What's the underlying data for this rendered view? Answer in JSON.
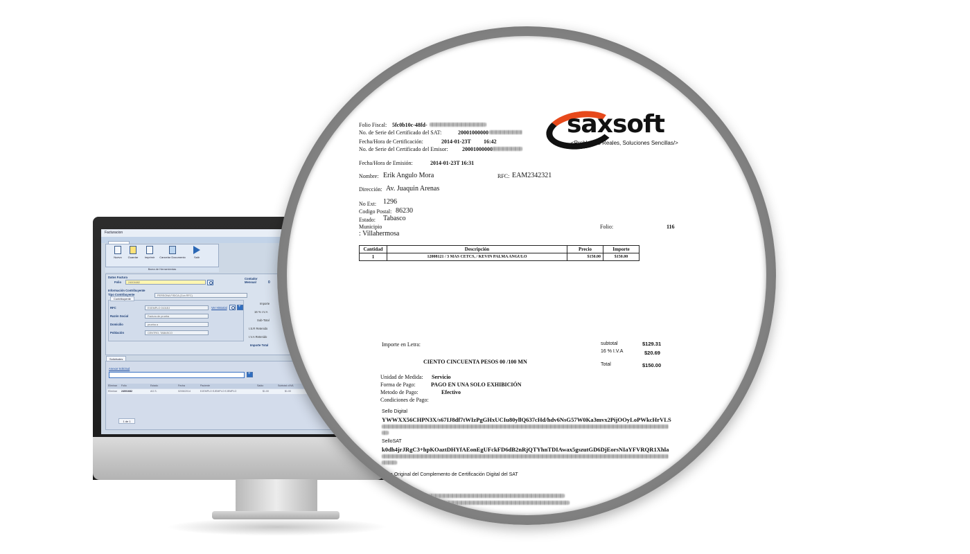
{
  "app": {
    "window_title": "Facturacion",
    "tab_label": "Procesos",
    "toolbar": {
      "nuevo": "Nuevo",
      "guardar": "Guardar",
      "imprimir": "Imprimir",
      "cancelar": "Cancelar Documento",
      "salir": "Salir",
      "caption": "Barra de Herramientas"
    },
    "datos_factura": "Datos Factura",
    "folio_label": "Folio",
    "folio_value": "24001682",
    "contador_label": "Contador Mensual",
    "contador_value": "0",
    "info_contribuyente": "Información Contribuyente",
    "tipo_label": "Tipo Contribuyente",
    "tipo_value": "PERSONA FISICA (Con RFC)",
    "contribuyente_tab": "Contribuyente",
    "rfc_label": "RFC",
    "rfc_value": "EXEMPLO 0101EJ",
    "ver_historial": "Ver Historial",
    "razon_label": "Razón Social",
    "razon_value": "Factura de prueba",
    "domicilio_label": "Domicilio",
    "domicilio_value": "prueba a",
    "poblacion_label": "Población",
    "poblacion_value": "CENTRO, TABASCO",
    "totals": [
      "Importe",
      "16 % I.V.A",
      "Sub-Total",
      "I.S.R Retenido",
      "I.V.A Retenido",
      "Importe Total"
    ],
    "solicitudes_tab": "Solicitudes",
    "anexar": "Anexar Solicitud",
    "grid_headers": [
      "Eliminar",
      "Folio",
      "Estado",
      "Fecha",
      "Paciente",
      "Saldo",
      "Subtotal c/IVA"
    ],
    "grid_row": [
      "Eliminar",
      "24001682",
      "AG.S.",
      "02/06/2014",
      "EJEMPLO EJEMPLO EJEMPLO",
      "$1.00",
      "$1.00"
    ],
    "pager": "1 de 1"
  },
  "invoice": {
    "folio_fiscal_label": "Folio Fiscal:",
    "folio_fiscal_value": "5fc0b10c-48fd-",
    "serie_sat_label": "No. de Serie del Certificado del SAT:",
    "serie_sat_value": "20001000000",
    "fecha_cert_label": "Fecha/Hora de Certificación:",
    "fecha_cert_date": "2014-01-23T",
    "fecha_cert_time": "16:42",
    "serie_emisor_label": "No. de Serie del Certificado del Emisor:",
    "serie_emisor_value": "20001000000",
    "fecha_emision_label": "Fecha/Hora de Emisión:",
    "fecha_emision_value": "2014-01-23T  16:31",
    "nombre_label": "Nombre:",
    "nombre_value": "Erik Angulo Mora",
    "rfc_label": "RFC:",
    "rfc_value": "EAM2342321",
    "direccion_label": "Dirección:",
    "direccion_value": "Av. Juaquin Arenas",
    "no_ext_label": "No Ext:",
    "no_ext_value": "1296",
    "cp_label": "Codigo Postal:",
    "cp_value": "86230",
    "estado_label": "Estado:",
    "estado_value": "Tabasco",
    "municipio_label": "Municipio",
    "municipio_value": ":  Villahermosa",
    "folio_label": "Folio:",
    "folio_value": "116",
    "table_headers": [
      "Cantidad",
      "Descripción",
      "Precio",
      "Importe"
    ],
    "table_rows": [
      [
        "1",
        "12008121  / 3 MAS CETCS,  / KEVIN  PALMA   ANGULO",
        "$150.00",
        "$150.00"
      ]
    ],
    "importe_letra_label": "Importe en Letra:",
    "importe_letra_value": "CIENTO CINCUENTA  PESOS 00 /100 MN",
    "subtotal_label": "subtotal",
    "subtotal_value": "$129.31",
    "iva_label": "16 % I.V.A",
    "iva_value": "$20.69",
    "total_label": "Total",
    "total_value": "$150.00",
    "unidad_label": "Unidad de Medida:",
    "unidad_value": "Servicio",
    "forma_label": "Forma de Pago:",
    "forma_value": "PAGO EN UNA SOLO EXHIBICIÓN",
    "metodo_label": "Metodo de Pago:",
    "metodo_value": "Efectivo",
    "condiciones_label": "Condiciones de Pago:",
    "sello_digital_label": "Sello Digital",
    "sello_digital_value": "YWWXX56CHPN3X/s67IJ8df7tWIzPgGHxUCIu80yllQ637cHd/hdv6NsG57W0Ka3mvx2PijOOyLoPWkcHrVLS",
    "sello_sat_label": "SelloSAT",
    "sello_sat_value": "k0dh4jrJRgC3+hpKOaztDHYfAEonEgUFckFD6dB2nRjQTYhnTDIAwax5gszutGD6DjEorsNIaYFVRQR1Xhla",
    "cadena_label": "a Original del Complemento de Certificación Digital del SAT"
  },
  "logo": {
    "text": "saxsoft",
    "tagline": "<Problemas Reales, Soluciones Sencillas/>",
    "colors": {
      "orange": "#e7491b",
      "black": "#111111"
    }
  }
}
